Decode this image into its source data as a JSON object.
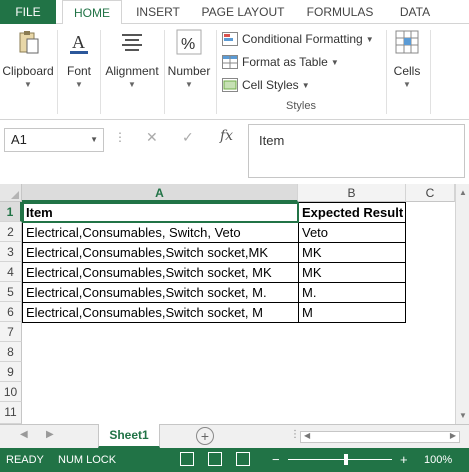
{
  "tabs": [
    "FILE",
    "HOME",
    "INSERT",
    "PAGE LAYOUT",
    "FORMULAS",
    "DATA"
  ],
  "ribbon": {
    "clipboard": "Clipboard",
    "font": "Font",
    "alignment": "Alignment",
    "number": "Number",
    "conditional_formatting": "Conditional Formatting",
    "format_as_table": "Format as Table",
    "cell_styles": "Cell Styles",
    "styles_group": "Styles",
    "cells": "Cells"
  },
  "formula_bar": {
    "name_box": "A1",
    "fx": "fx",
    "content": "Item"
  },
  "grid": {
    "columns": [
      "A",
      "B",
      "C"
    ],
    "rows": [
      "1",
      "2",
      "3",
      "4",
      "5",
      "6",
      "7",
      "8",
      "9",
      "10",
      "11"
    ],
    "cells": [
      [
        "Item",
        "Expected Result"
      ],
      [
        "Electrical,Consumables, Switch, Veto",
        "Veto"
      ],
      [
        "Electrical,Consumables,Switch socket,MK",
        "MK"
      ],
      [
        "Electrical,Consumables,Switch socket,  MK",
        "MK"
      ],
      [
        "Electrical,Consumables,Switch socket,  M.",
        "M."
      ],
      [
        "Electrical,Consumables,Switch socket,  M",
        "M"
      ]
    ]
  },
  "sheet_tab": "Sheet1",
  "status": {
    "ready": "READY",
    "num_lock": "NUM LOCK",
    "zoom": "100%"
  },
  "colors": {
    "accent": "#217346"
  }
}
